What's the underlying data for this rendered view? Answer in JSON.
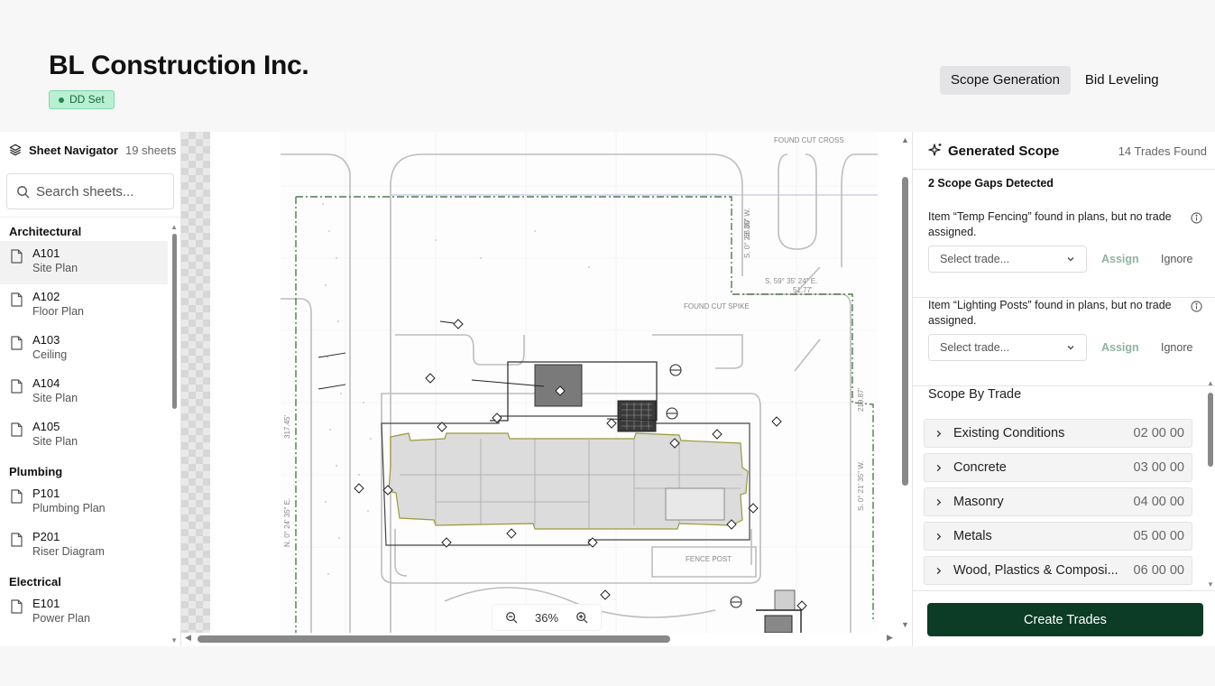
{
  "header": {
    "company_name": "BL Construction Inc.",
    "badge": "DD Set",
    "tabs": [
      {
        "label": "Scope Generation",
        "active": true
      },
      {
        "label": "Bid Leveling",
        "active": false
      }
    ]
  },
  "navigator": {
    "title": "Sheet Navigator",
    "count": "19 sheets",
    "search_placeholder": "Search sheets...",
    "groups": [
      {
        "label": "Architectural",
        "sheets": [
          {
            "code": "A101",
            "desc": "Site Plan"
          },
          {
            "code": "A102",
            "desc": "Floor Plan"
          },
          {
            "code": "A103",
            "desc": "Ceiling"
          },
          {
            "code": "A104",
            "desc": "Site Plan"
          },
          {
            "code": "A105",
            "desc": "Site Plan"
          }
        ]
      },
      {
        "label": "Plumbing",
        "sheets": [
          {
            "code": "P101",
            "desc": "Plumbing Plan"
          },
          {
            "code": "P201",
            "desc": "Riser Diagram"
          }
        ]
      },
      {
        "label": "Electrical",
        "sheets": [
          {
            "code": "E101",
            "desc": "Power Plan"
          }
        ]
      }
    ]
  },
  "viewer": {
    "zoom": "36%"
  },
  "scope": {
    "title": "Generated Scope",
    "trades_found": "14 Trades Found",
    "gaps_detected": "2 Scope Gaps Detected",
    "gaps": [
      {
        "text": "Item “Temp Fencing” found in plans, but no trade assigned.",
        "select_placeholder": "Select trade...",
        "assign": "Assign",
        "ignore": "Ignore"
      },
      {
        "text": "Item “Lighting Posts” found in plans, but no trade assigned.",
        "select_placeholder": "Select trade...",
        "assign": "Assign",
        "ignore": "Ignore"
      }
    ],
    "by_trade_label": "Scope By Trade",
    "trades": [
      {
        "name": "Existing Conditions",
        "code": "02 00 00"
      },
      {
        "name": "Concrete",
        "code": "03 00 00"
      },
      {
        "name": "Masonry",
        "code": "04 00 00"
      },
      {
        "name": "Metals",
        "code": "05 00 00"
      },
      {
        "name": "Wood, Plastics & Composi...",
        "code": "06 00 00"
      }
    ],
    "create_button": "Create Trades"
  },
  "colors": {
    "primary": "#0c3b26",
    "badge_bg": "#b9f0d3",
    "badge_text": "#17683d",
    "assign_text": "#8fb3a2"
  }
}
